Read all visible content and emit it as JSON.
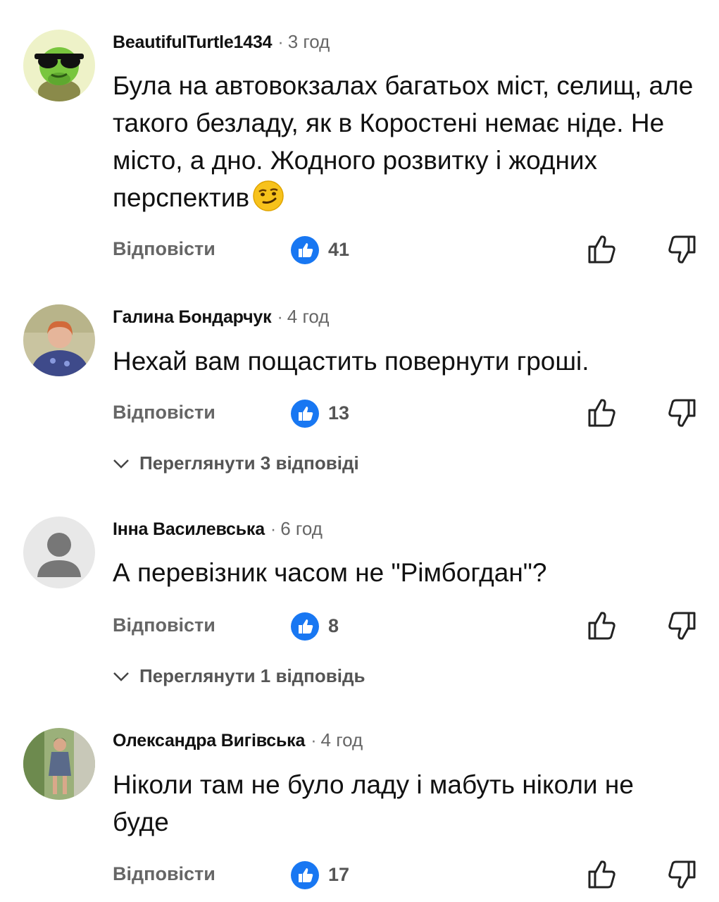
{
  "colors": {
    "like_blue": "#1877f2",
    "text": "#111111",
    "meta": "#666666"
  },
  "labels": {
    "reply": "Відповісти"
  },
  "comments": [
    {
      "author": "BeautifulTurtle1434",
      "time": "3 год",
      "text": "Була на автовокзалах багатьох міст, селищ, але такого безладу, як в Коростені немає ніде. Не місто, а дно. Жодного розвитку і жодних перспектив",
      "emoji": "smirk-emoji",
      "likes": "41",
      "avatar": "turtle-sunglasses-avatar"
    },
    {
      "author": "Галина Бондарчук",
      "time": "4 год",
      "text": "Нехай вам пощастить повернути гроші.",
      "likes": "13",
      "view_replies": "Переглянути 3 відповіді",
      "avatar": "photo-avatar"
    },
    {
      "author": "Інна Василевська",
      "time": "6 год",
      "text": "А перевізник часом не \"Рімбогдан\"?",
      "likes": "8",
      "view_replies": "Переглянути 1 відповідь",
      "avatar": "default-user-avatar"
    },
    {
      "author": "Олександра Вигівська",
      "time": "4 год",
      "text": "Ніколи там не було ладу і мабуть ніколи не буде",
      "likes": "17",
      "avatar": "photo-avatar"
    }
  ]
}
